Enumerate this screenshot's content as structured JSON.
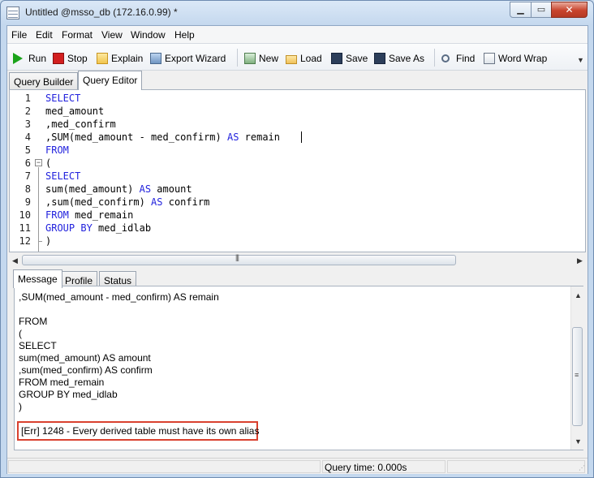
{
  "window": {
    "title": "Untitled @msso_db (172.16.0.99) *"
  },
  "menu": [
    "File",
    "Edit",
    "Format",
    "View",
    "Window",
    "Help"
  ],
  "toolbar": {
    "run": "Run",
    "stop": "Stop",
    "explain": "Explain",
    "export": "Export Wizard",
    "new": "New",
    "load": "Load",
    "save": "Save",
    "saveas": "Save As",
    "find": "Find",
    "wordwrap": "Word Wrap"
  },
  "tabs": {
    "builder": "Query Builder",
    "editor": "Query Editor"
  },
  "editor": {
    "lines": [
      {
        "n": "1",
        "a": "",
        "k": "SELECT",
        "b": ""
      },
      {
        "n": "2",
        "a": "med_amount",
        "k": "",
        "b": ""
      },
      {
        "n": "3",
        "a": ",med_confirm",
        "k": "",
        "b": ""
      },
      {
        "n": "4",
        "a": ",SUM(med_amount - med_confirm) ",
        "k": "AS",
        "b": " remain"
      },
      {
        "n": "5",
        "a": "",
        "k": "FROM",
        "b": ""
      },
      {
        "n": "6",
        "a": "(",
        "k": "",
        "b": ""
      },
      {
        "n": "7",
        "a": "",
        "k": "SELECT",
        "b": ""
      },
      {
        "n": "8",
        "a": "sum(med_amount) ",
        "k": "AS",
        "b": " amount"
      },
      {
        "n": "9",
        "a": ",sum(med_confirm) ",
        "k": "AS",
        "b": " confirm"
      },
      {
        "n": "10",
        "a": "",
        "k": "FROM",
        "b": " med_remain"
      },
      {
        "n": "11",
        "a": "",
        "k": "GROUP BY",
        "b": " med_idlab"
      },
      {
        "n": "12",
        "a": ")",
        "k": "",
        "b": ""
      }
    ]
  },
  "result_tabs": {
    "message": "Message",
    "profile": "Profile",
    "status": "Status"
  },
  "messages": [
    ",SUM(med_amount - med_confirm) AS remain",
    "",
    "FROM",
    "(",
    "SELECT",
    "sum(med_amount) AS amount",
    ",sum(med_confirm) AS confirm",
    "FROM med_remain",
    "GROUP BY med_idlab",
    ")"
  ],
  "error": "[Err] 1248 - Every derived table must have its own alias",
  "status": {
    "query_time": "Query time: 0.000s"
  },
  "colors": {
    "keyword": "#2222dd",
    "error_border": "#d9412f",
    "run_icon": "#1aa31a",
    "stop_icon": "#d21f1f"
  }
}
